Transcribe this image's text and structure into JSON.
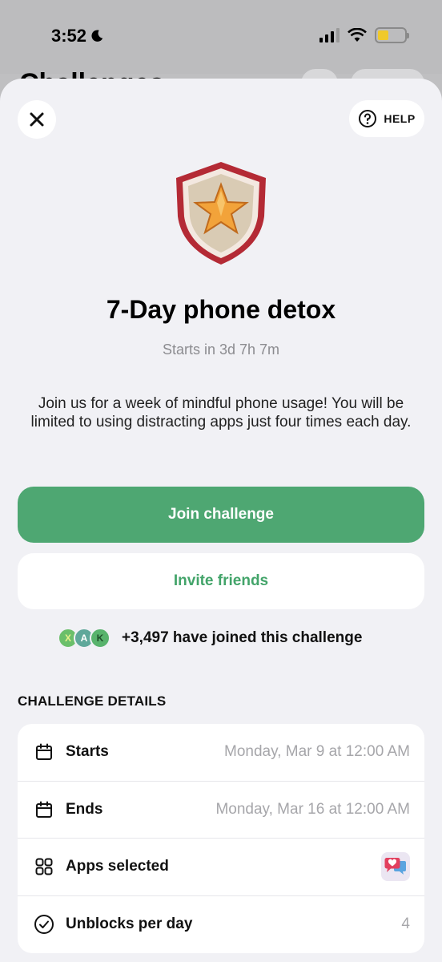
{
  "status_bar": {
    "time": "3:52",
    "icons": [
      "moon-icon",
      "signal-icon",
      "wifi-icon",
      "battery-icon"
    ],
    "battery_level": 0.4
  },
  "background_page": {
    "title": "Challenges"
  },
  "sheet": {
    "help_label": "HELP",
    "badge_icon": "star-shield-icon",
    "title": "7-Day phone detox",
    "subtitle": "Starts in 3d 7h 7m",
    "description": "Join us for a week of mindful phone usage! You will be limited to using distracting apps just four times each day.",
    "join_label": "Join challenge",
    "invite_label": "Invite friends",
    "participants": {
      "avatars": [
        {
          "initial": "X",
          "color": "#6bbf6a"
        },
        {
          "initial": "A",
          "color": "#5fa89a"
        },
        {
          "initial": "K",
          "color": "#58b36c"
        }
      ],
      "text": "+3,497 have joined this challenge"
    },
    "details_header": "CHALLENGE DETAILS",
    "details": {
      "starts": {
        "label": "Starts",
        "value": "Monday, Mar 9 at 12:00 AM",
        "icon": "calendar-icon"
      },
      "ends": {
        "label": "Ends",
        "value": "Monday, Mar 16 at 12:00 AM",
        "icon": "calendar-icon"
      },
      "apps": {
        "label": "Apps selected",
        "icon": "apps-grid-icon",
        "app_icon": "chat-heart-app-icon"
      },
      "unblocks": {
        "label": "Unblocks per day",
        "value": "4",
        "icon": "check-circle-icon"
      }
    }
  },
  "colors": {
    "primary_green": "#4ea772",
    "sheet_bg": "#f1f1f5",
    "muted_text": "#a6a6aa"
  }
}
